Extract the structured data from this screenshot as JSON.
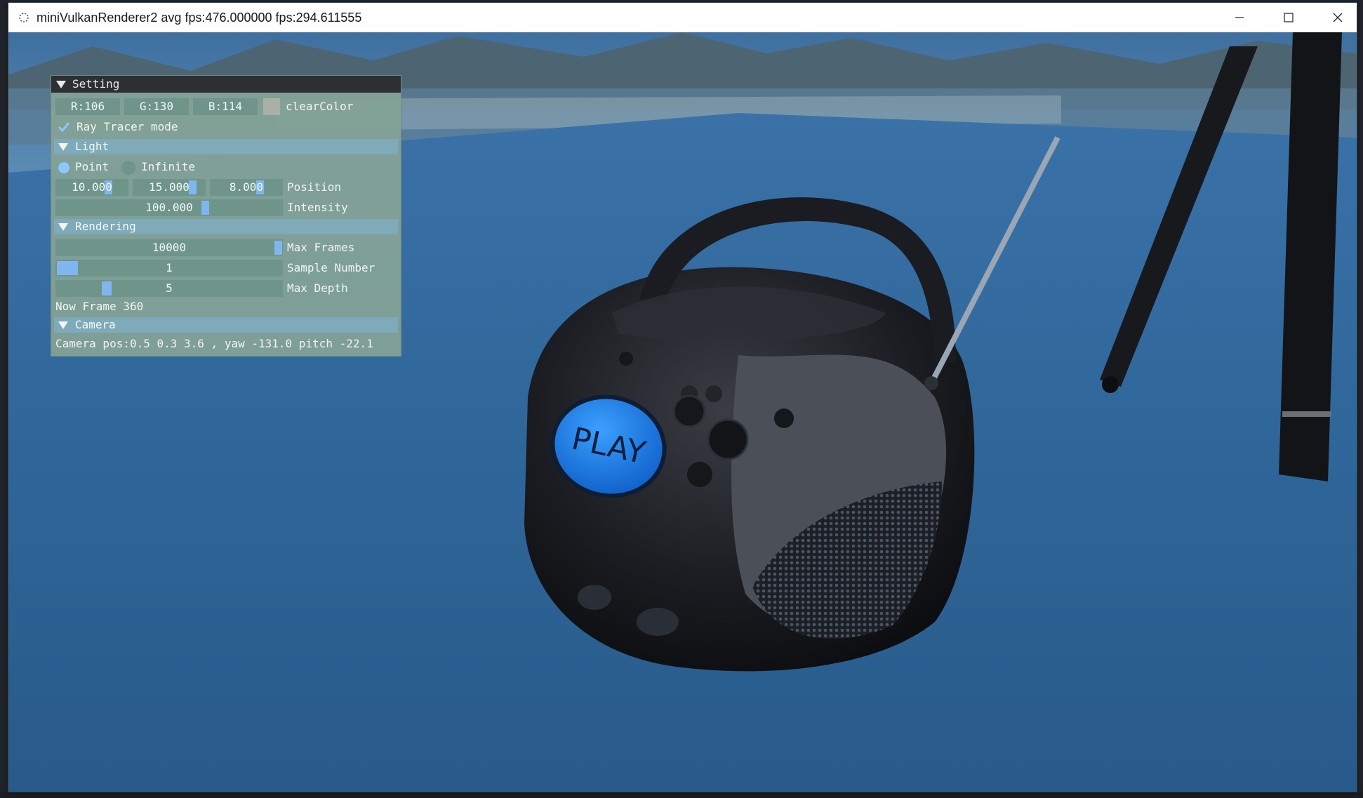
{
  "window": {
    "title": "miniVulkanRenderer2 avg fps:476.000000 fps:294.611555",
    "buttons": {
      "minimize": "minimize-icon",
      "maximize": "maximize-icon",
      "close": "close-icon"
    }
  },
  "scene": {
    "screen_label": "PLAY",
    "colors": {
      "floor": "#2f6496",
      "sky": "#4a7fb0",
      "mountains": "#3c5565",
      "accent": "#1e7ff0"
    }
  },
  "panel": {
    "title": "Setting",
    "clear_color": {
      "r": "R:106",
      "g": "G:130",
      "b": "B:114",
      "label": "clearColor",
      "swatch": "#a8b0a8"
    },
    "ray_tracer": {
      "label": "Ray Tracer mode",
      "checked": true
    },
    "light": {
      "header": "Light",
      "type_point": "Point",
      "type_infinite": "Infinite",
      "selected": "Point",
      "position": [
        "10.000",
        "15.000",
        "8.000"
      ],
      "position_label": "Position",
      "intensity": "100.000",
      "intensity_label": "Intensity"
    },
    "rendering": {
      "header": "Rendering",
      "max_frames": "10000",
      "max_frames_label": "Max Frames",
      "sample_number": "1",
      "sample_number_label": "Sample Number",
      "max_depth": "5",
      "max_depth_label": "Max Depth",
      "now_frame": "Now Frame 360"
    },
    "camera": {
      "header": "Camera",
      "info": "Camera pos:0.5 0.3 3.6 , yaw -131.0 pitch -22.1"
    }
  }
}
